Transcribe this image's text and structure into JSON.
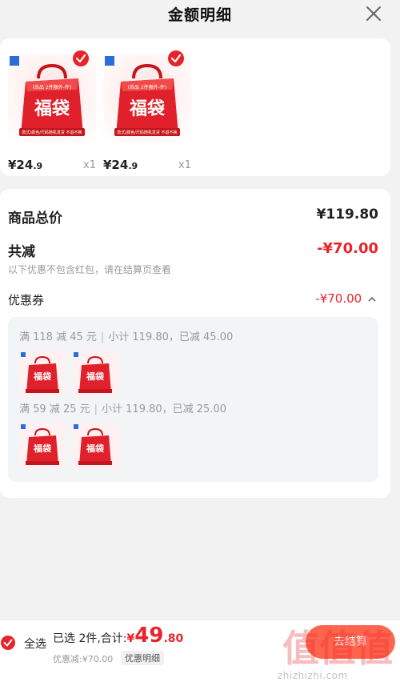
{
  "header": {
    "title": "金额明细"
  },
  "products": [
    {
      "bag_banner": "(尚品 2件额外-件)",
      "bag_text": "福袋",
      "bag_sub": "款式/颜色/尺码随机发货 不退不换",
      "price_int": "¥24",
      "price_dec": ".9",
      "qty": "x1"
    },
    {
      "bag_banner": "(尚品 2件额外-件)",
      "bag_text": "福袋",
      "bag_sub": "款式/颜色/尺码随机发货 不退不换",
      "price_int": "¥24",
      "price_dec": ".9",
      "qty": "x1"
    }
  ],
  "summary": {
    "goods_total_label": "商品总价",
    "goods_total_value": "¥119.80",
    "reduction_label": "共减",
    "reduction_value": "-¥70.00",
    "reduction_note": "以下优惠不包含红包，请在结算页查看",
    "coupon_label": "优惠券",
    "coupon_value": "-¥70.00",
    "coupon_rules": [
      {
        "rule": "满 118 减 45 元",
        "detail": "小计 119.80，已减 45.00",
        "mini_bag_text": "福袋"
      },
      {
        "rule": "满 59 减 25 元",
        "detail": "小计 119.80，已减 25.00",
        "mini_bag_text": "福袋"
      }
    ]
  },
  "bottom": {
    "select_all": "全选",
    "selected_text": "已选 2件,合计:",
    "total_symbol": "¥",
    "total_int": "49",
    "total_dec": ".80",
    "discount_text": "优惠减:¥70.00",
    "detail_button": "优惠明细",
    "checkout_button": "去结算"
  },
  "watermark": {
    "glyphs": "值值值",
    "site": "zhizhizhi.com"
  },
  "colors": {
    "accent_red": "#e8242b",
    "bag_red": "#e0202a",
    "checkout_orange": "#ff4a2f",
    "background": "#f2f2f2"
  },
  "icons": {
    "close": "close-icon",
    "check": "checkmark-circle-icon",
    "caret": "chevron-up-icon"
  }
}
